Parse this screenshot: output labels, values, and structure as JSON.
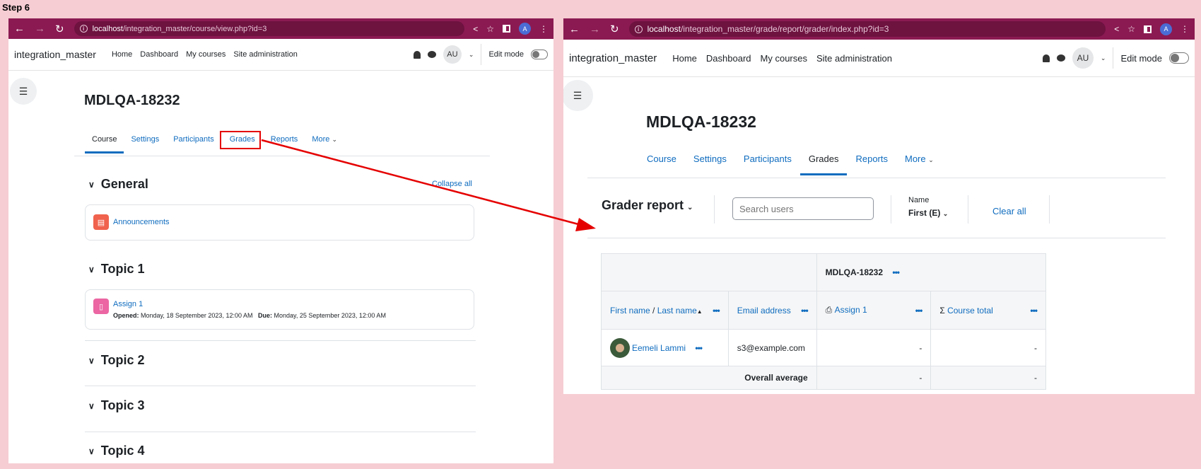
{
  "step_label": "Step 6",
  "left": {
    "url_host": "localhost",
    "url_path": "/integration_master/course/view.php?id=3",
    "site_name": "integration_master",
    "nav": [
      "Home",
      "Dashboard",
      "My courses",
      "Site administration"
    ],
    "avatar_initials": "AU",
    "edit_mode": "Edit mode",
    "course_title": "MDLQA-18232",
    "tabs": [
      "Course",
      "Settings",
      "Participants",
      "Grades",
      "Reports",
      "More"
    ],
    "collapse_all": "Collapse all",
    "sections": {
      "general": "General",
      "topic1": "Topic 1",
      "topic2": "Topic 2",
      "topic3": "Topic 3",
      "topic4": "Topic 4"
    },
    "announcements": "Announcements",
    "assign": {
      "name": "Assign 1",
      "opened_label": "Opened:",
      "opened_value": "Monday, 18 September 2023, 12:00 AM",
      "due_label": "Due:",
      "due_value": "Monday, 25 September 2023, 12:00 AM"
    }
  },
  "right": {
    "url_host": "localhost",
    "url_path": "/integration_master/grade/report/grader/index.php?id=3",
    "site_name": "integration_master",
    "nav": [
      "Home",
      "Dashboard",
      "My courses",
      "Site administration"
    ],
    "avatar_initials": "AU",
    "edit_mode": "Edit mode",
    "course_title": "MDLQA-18232",
    "tabs": [
      "Course",
      "Settings",
      "Participants",
      "Grades",
      "Reports",
      "More"
    ],
    "grader_report": "Grader report",
    "search_placeholder": "Search users",
    "name_label": "Name",
    "name_value": "First (E)",
    "clear_all": "Clear all",
    "table": {
      "course_header": "MDLQA-18232",
      "col_first": "First name",
      "col_sep": " / ",
      "col_last": "Last name",
      "col_email": "Email address",
      "col_assign": "Assign 1",
      "col_total": "Course total",
      "row_name": "Eemeli Lammi",
      "row_email": "s3@example.com",
      "row_assign": "-",
      "row_total": "-",
      "avg_label": "Overall average",
      "avg_assign": "-",
      "avg_total": "-"
    }
  },
  "colors": {
    "chrome": "#8b1a52",
    "link": "#0f6cbf",
    "highlight": "#e50000",
    "background": "#f6cdd3"
  }
}
